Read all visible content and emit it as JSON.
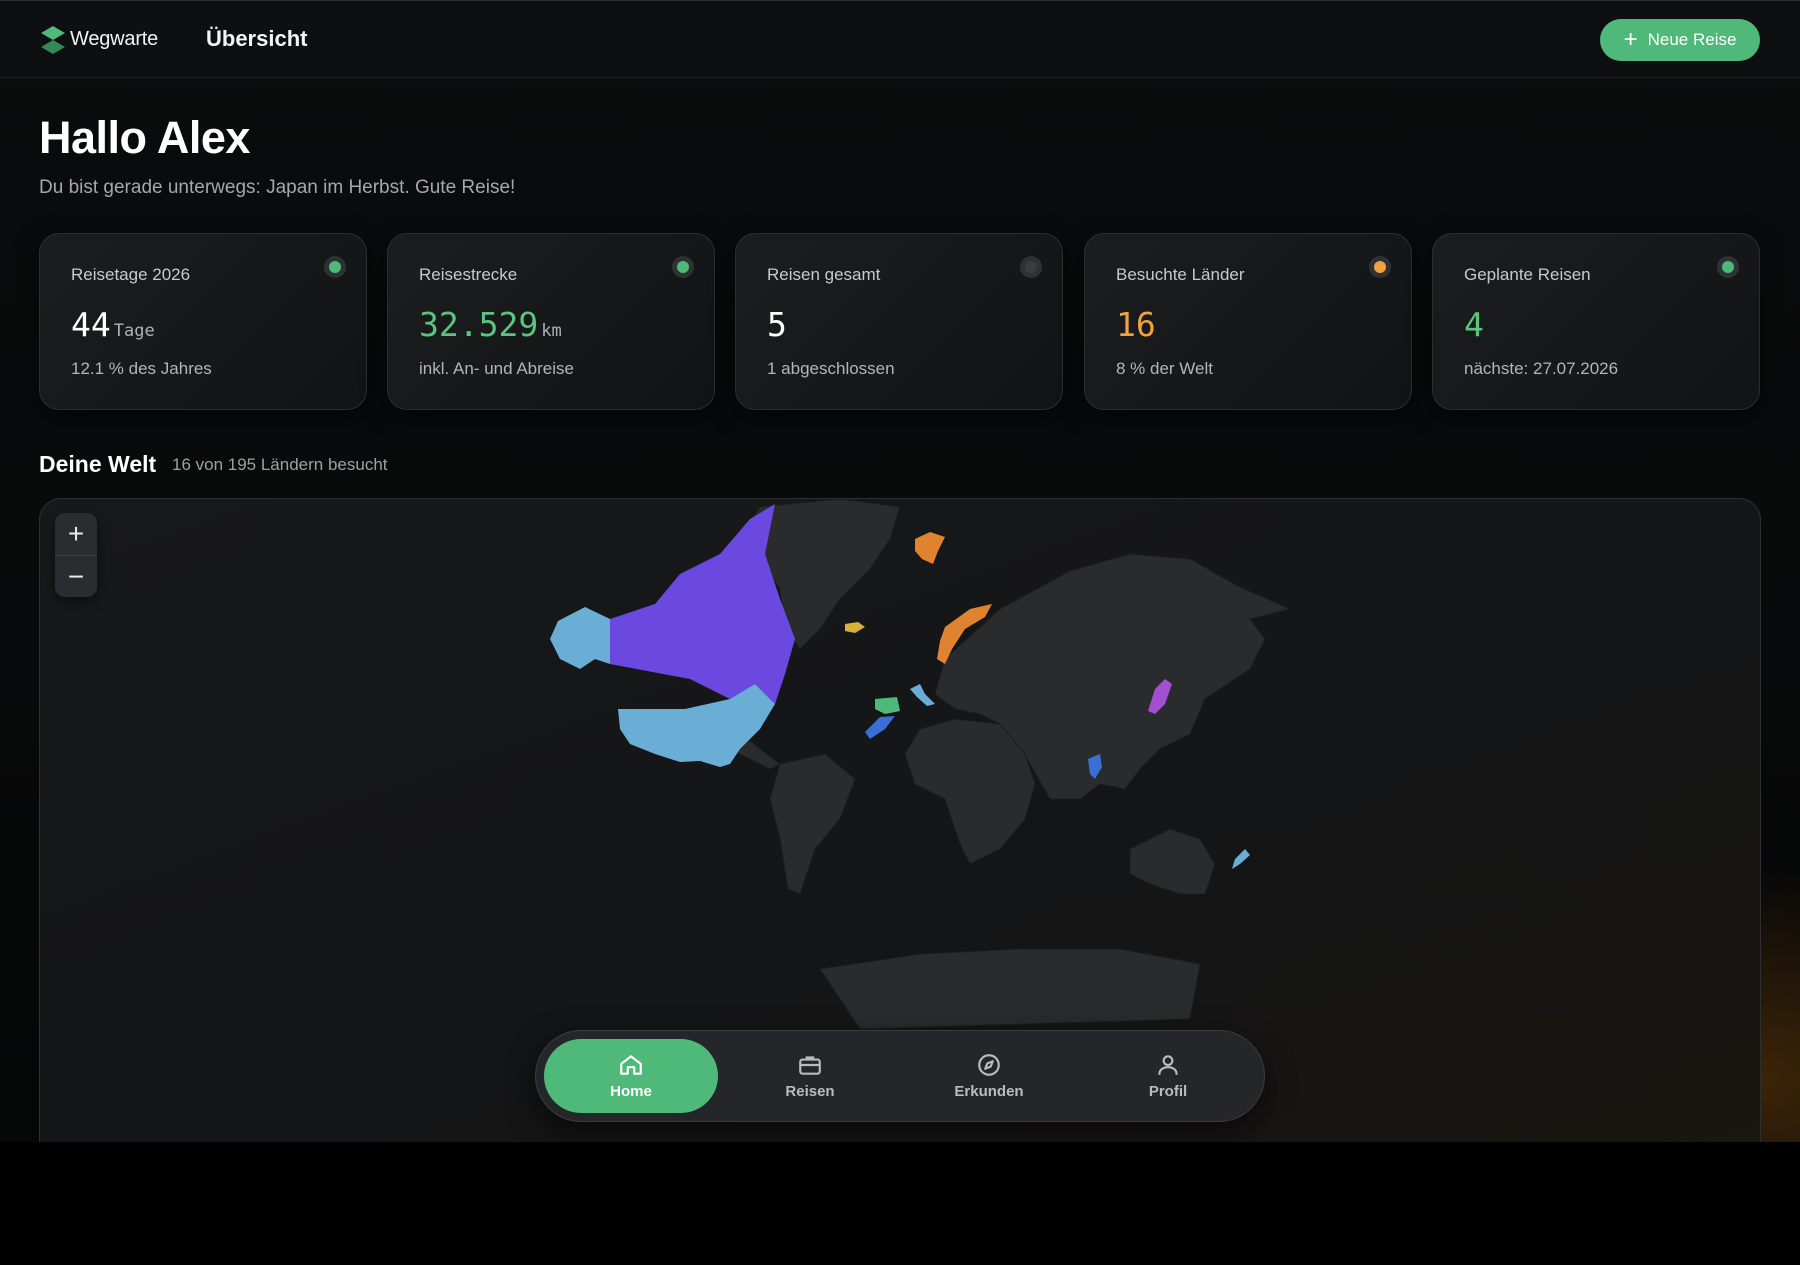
{
  "header": {
    "brand": "Wegwarte",
    "title": "Übersicht",
    "new_trip_label": "Neue Reise"
  },
  "greeting": {
    "title": "Hallo Alex",
    "subtitle": "Du bist gerade unterwegs: Japan im Herbst. Gute Reise!"
  },
  "stats": [
    {
      "label": "Reisetage 2026",
      "value": "44",
      "unit": "Tage",
      "note": "12.1 % des Jahres",
      "value_color": "#ffffff",
      "dot_color": "#4fb97a"
    },
    {
      "label": "Reisestrecke",
      "value": "32.529",
      "unit": "km",
      "note": "inkl. An- und Abreise",
      "value_color": "#5bc47f",
      "dot_color": "#4fb97a"
    },
    {
      "label": "Reisen gesamt",
      "value": "5",
      "unit": "",
      "note": "1 abgeschlossen",
      "value_color": "#ffffff",
      "dot_color": "#3a3c3e"
    },
    {
      "label": "Besuchte Länder",
      "value": "16",
      "unit": "",
      "note": "8 % der Welt",
      "value_color": "#f0a240",
      "dot_color": "#f0a240"
    },
    {
      "label": "Geplante Reisen",
      "value": "4",
      "unit": "",
      "note": "nächste: 27.07.2026",
      "value_color": "#5bc47f",
      "dot_color": "#4fb97a"
    }
  ],
  "world": {
    "title": "Deine Welt",
    "meta": "16 von 195 Ländern besucht",
    "zoom_in": "+",
    "zoom_out": "−",
    "colors": {
      "land": "#2a2b2d",
      "canada": "#6b49e0",
      "usa_alaska": "#6aaed6",
      "svalbard_norway": "#e0832f",
      "iceland": "#d8b13a",
      "spain": "#4fb97a",
      "morocco": "#3a6fd8",
      "japan": "#a24fd0",
      "thailand": "#3a6fd8",
      "new_zealand": "#6aaed6",
      "italy_alps": "#6aaed6"
    }
  },
  "bottom_nav": [
    {
      "label": "Home",
      "icon": "home-icon",
      "active": true
    },
    {
      "label": "Reisen",
      "icon": "briefcase-icon",
      "active": false
    },
    {
      "label": "Erkunden",
      "icon": "compass-icon",
      "active": false
    },
    {
      "label": "Profil",
      "icon": "user-icon",
      "active": false
    }
  ],
  "accent": "#4fb97a"
}
